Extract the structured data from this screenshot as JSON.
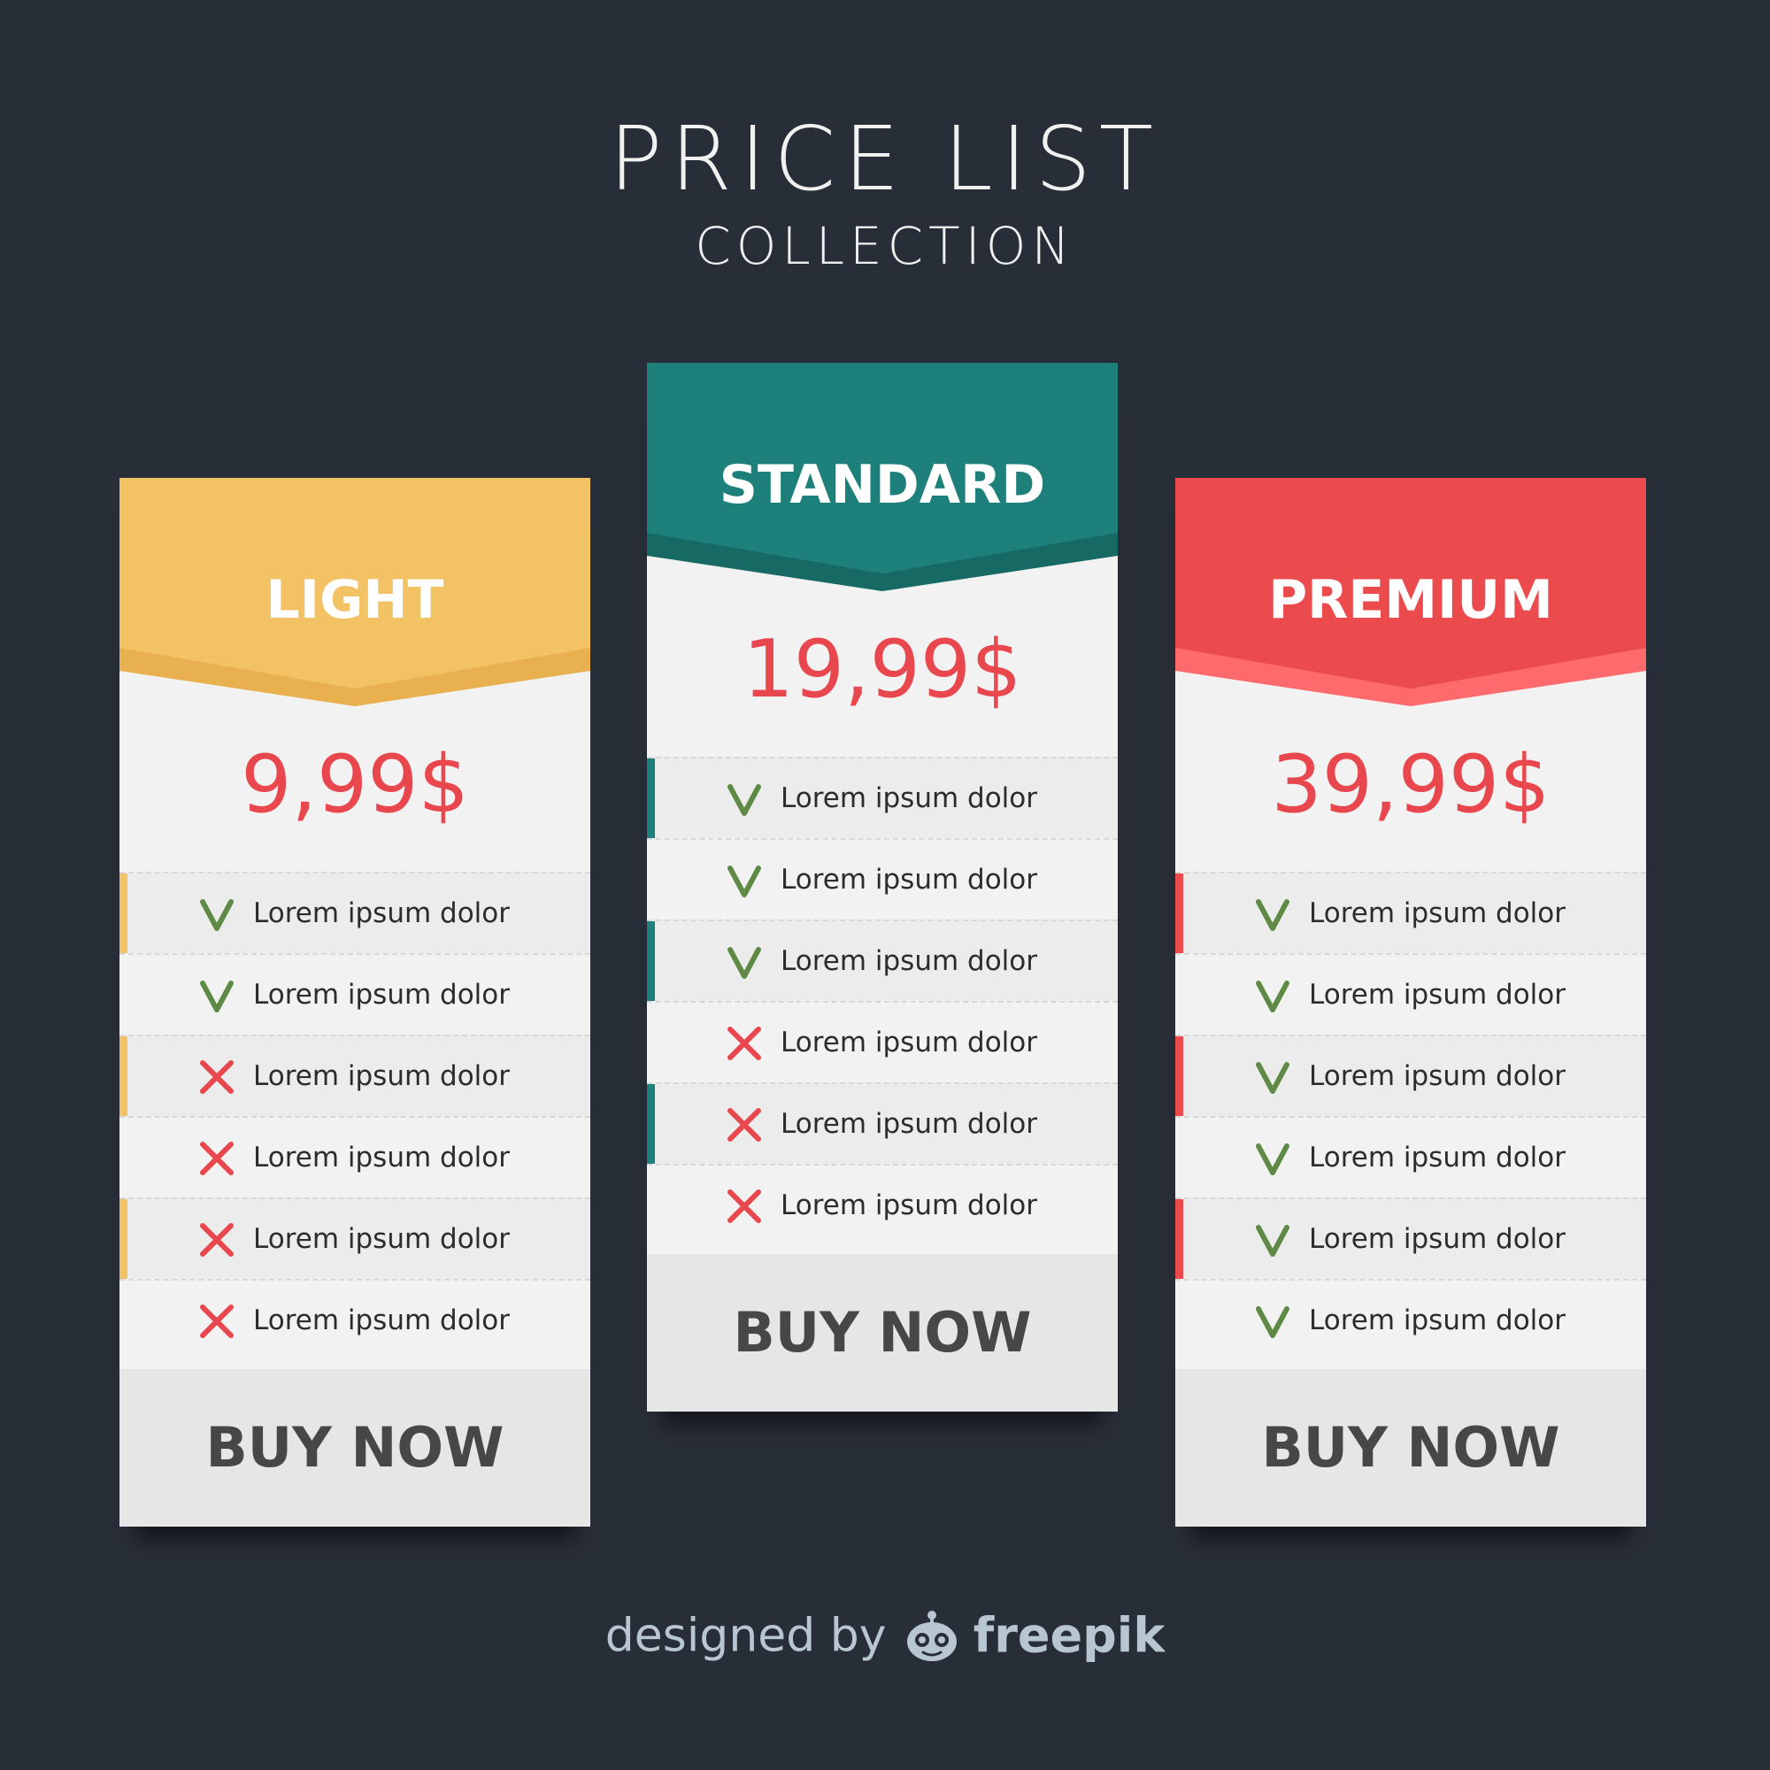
{
  "header": {
    "title": "PRICE LIST",
    "subtitle": "COLLECTION"
  },
  "plans": [
    {
      "name": "LIGHT",
      "price": "9,99$",
      "color": "#f2c265",
      "color_dark": "#e8b04f",
      "features": [
        {
          "label": "Lorem ipsum dolor",
          "included": true
        },
        {
          "label": "Lorem ipsum dolor",
          "included": true
        },
        {
          "label": "Lorem ipsum dolor",
          "included": false
        },
        {
          "label": "Lorem ipsum dolor",
          "included": false
        },
        {
          "label": "Lorem ipsum dolor",
          "included": false
        },
        {
          "label": "Lorem ipsum dolor",
          "included": false
        }
      ],
      "button": "BUY NOW"
    },
    {
      "name": "STANDARD",
      "price": "19,99$",
      "color": "#1e807b",
      "color_dark": "#176a64",
      "features": [
        {
          "label": "Lorem ipsum dolor",
          "included": true
        },
        {
          "label": "Lorem ipsum dolor",
          "included": true
        },
        {
          "label": "Lorem ipsum dolor",
          "included": true
        },
        {
          "label": "Lorem ipsum dolor",
          "included": false
        },
        {
          "label": "Lorem ipsum dolor",
          "included": false
        },
        {
          "label": "Lorem ipsum dolor",
          "included": false
        }
      ],
      "button": "BUY NOW"
    },
    {
      "name": "PREMIUM",
      "price": "39,99$",
      "color": "#ec4b4e",
      "color_dark": "#ff6a6c",
      "features": [
        {
          "label": "Lorem ipsum dolor",
          "included": true
        },
        {
          "label": "Lorem ipsum dolor",
          "included": true
        },
        {
          "label": "Lorem ipsum dolor",
          "included": true
        },
        {
          "label": "Lorem ipsum dolor",
          "included": true
        },
        {
          "label": "Lorem ipsum dolor",
          "included": true
        },
        {
          "label": "Lorem ipsum dolor",
          "included": true
        }
      ],
      "button": "BUY NOW"
    }
  ],
  "icons": {
    "included": "checkmark-icon",
    "excluded": "cross-icon"
  },
  "colors": {
    "background": "#282e37",
    "card": "#f2f2f2",
    "row_alt": "#ececec",
    "price": "#e9474e",
    "check": "#5e8a45",
    "cross": "#e9474e",
    "button_bg": "#e6e6e6",
    "button_text": "#474747"
  },
  "footer": {
    "designed_by": "designed by",
    "brand": "freepik",
    "brand_icon": "freepik-logo-icon"
  }
}
